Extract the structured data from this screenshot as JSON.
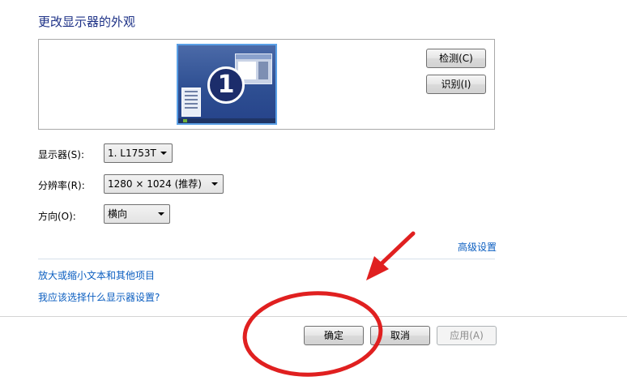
{
  "page": {
    "title": "更改显示器的外观"
  },
  "preview": {
    "monitor_number": "1"
  },
  "buttons": {
    "detect": "检测(C)",
    "identify": "识别(I)",
    "ok": "确定",
    "cancel": "取消",
    "apply": "应用(A)"
  },
  "settings": {
    "display_label": "显示器(S):",
    "display_value": "1. L1753T",
    "resolution_label": "分辨率(R):",
    "resolution_value": "1280 × 1024 (推荐)",
    "orientation_label": "方向(O):",
    "orientation_value": "横向"
  },
  "links": {
    "advanced": "高级设置",
    "text_size": "放大或缩小文本和其他项目",
    "which_settings": "我应该选择什么显示器设置?"
  },
  "annotation_color": "#e02020"
}
